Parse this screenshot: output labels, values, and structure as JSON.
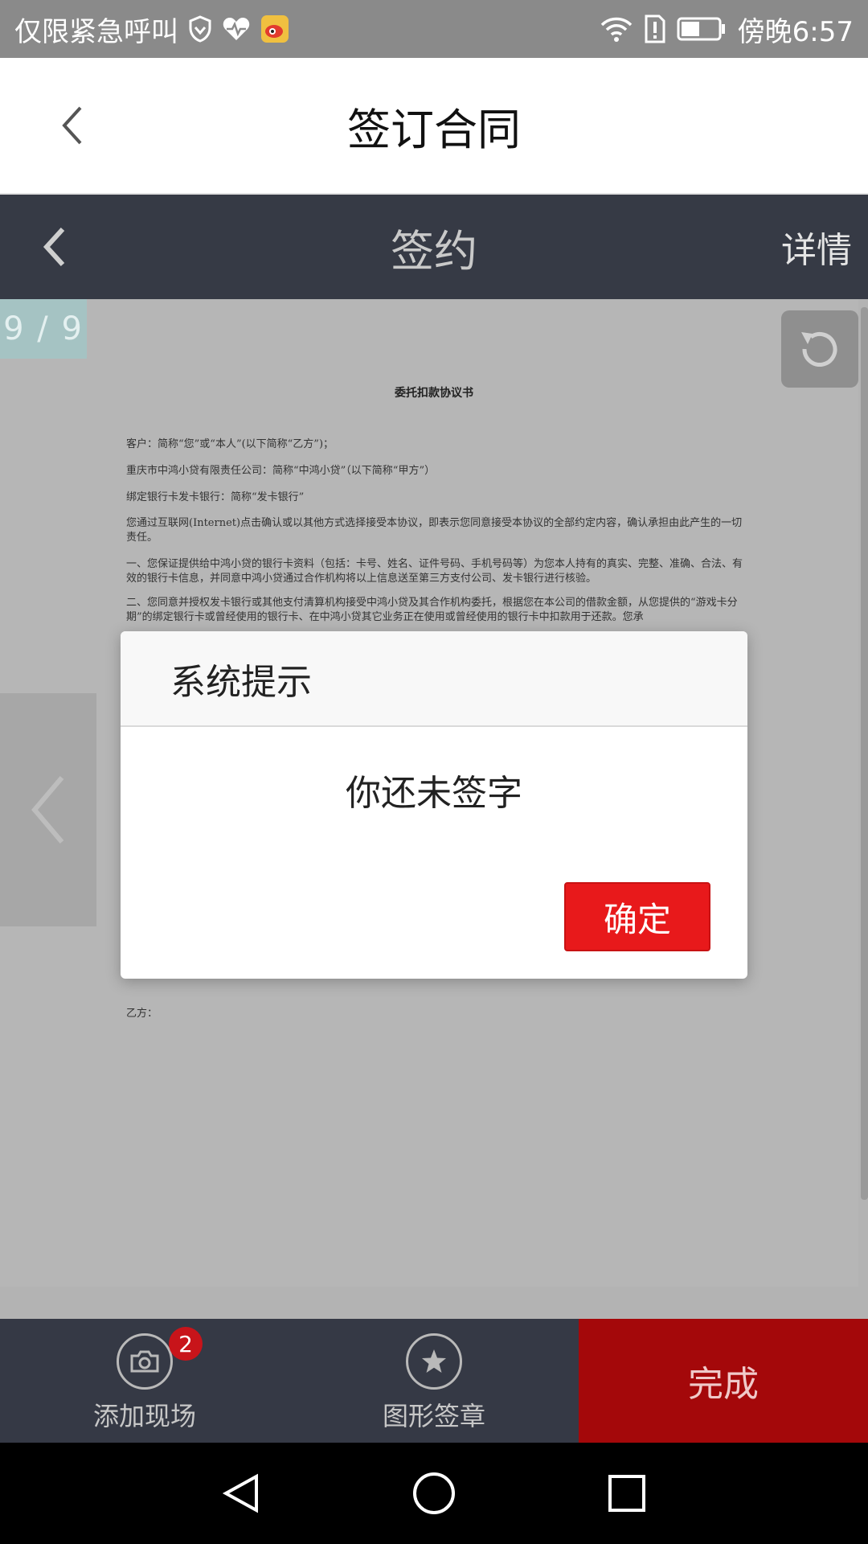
{
  "status_bar": {
    "carrier_text": "仅限紧急呼叫",
    "time": "傍晚6:57"
  },
  "app_header": {
    "title": "签订合同"
  },
  "inner_nav": {
    "title": "签约",
    "detail_label": "详情"
  },
  "document": {
    "page_indicator": "9 / 9",
    "title": "委托扣款协议书",
    "lines": [
      "客户：简称“您”或“本人”(以下简称“乙方”)；",
      "重庆市中鸿小贷有限责任公司：简称“中鸿小贷”（以下简称“甲方”）",
      "绑定银行卡发卡银行：简称“发卡银行”",
      "您通过互联网(Internet)点击确认或以其他方式选择接受本协议，即表示您同意接受本协议的全部约定内容，确认承担由此产生的一切责任。",
      "一、您保证提供给中鸿小贷的银行卡资料（包括：卡号、姓名、证件号码、手机号码等）为您本人持有的真实、完整、准确、合法、有效的银行卡信息，并同意中鸿小贷通过合作机构将以上信息送至第三方支付公司、发卡银行进行核验。",
      "二、您同意并授权发卡银行或其他支付清算机构接受中鸿小贷及其合作机构委托，根据您在本公司的借款金额，从您提供的“游戏卡分期”的绑定银行卡或曾经使用的银行卡、在中鸿小贷其它业务正在使用或曾经使用的银行卡中扣款用于还款。您承"
    ],
    "party_b_label": "乙方："
  },
  "dialog": {
    "title": "系统提示",
    "message": "你还未签字",
    "confirm_label": "确定"
  },
  "bottom_bar": {
    "add_scene_label": "添加现场",
    "add_scene_badge": "2",
    "graphic_seal_label": "图形签章",
    "finish_label": "完成"
  },
  "icons": {
    "status": [
      "shield-icon",
      "heartbeat-icon",
      "weibo-icon",
      "wifi-icon",
      "alert-icon",
      "battery-icon"
    ],
    "app": [
      "back-arrow-icon",
      "rotate-icon",
      "camera-icon",
      "star-icon"
    ],
    "nav": [
      "back-triangle-icon",
      "home-circle-icon",
      "recents-square-icon"
    ]
  },
  "colors": {
    "dark_nav": "#363a45",
    "confirm_red": "#e8191b",
    "finish_red": "#a4080a",
    "badge_red": "#c8141a"
  }
}
